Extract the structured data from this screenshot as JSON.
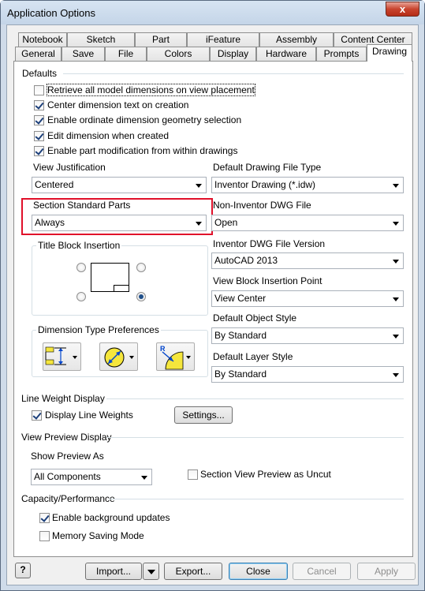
{
  "window": {
    "title": "Application Options",
    "close_glyph": "x"
  },
  "tabs": {
    "row1": [
      "Notebook",
      "Sketch",
      "Part",
      "iFeature",
      "Assembly",
      "Content Center"
    ],
    "row2": [
      "General",
      "Save",
      "File",
      "Colors",
      "Display",
      "Hardware",
      "Prompts",
      "Drawing"
    ],
    "active": "Drawing"
  },
  "defaults": {
    "label": "Defaults",
    "checkboxes": [
      {
        "label": "Retrieve all model dimensions on view placement",
        "checked": false
      },
      {
        "label": "Center dimension text on creation",
        "checked": true
      },
      {
        "label": "Enable ordinate dimension geometry selection",
        "checked": true
      },
      {
        "label": "Edit dimension when created",
        "checked": true
      },
      {
        "label": "Enable part modification from within drawings",
        "checked": true
      }
    ]
  },
  "view_justification": {
    "label": "View Justification",
    "value": "Centered"
  },
  "section_standard_parts": {
    "label": "Section Standard Parts",
    "value": "Always",
    "highlight_color": "#e0102a"
  },
  "title_block_insertion": {
    "label": "Title Block Insertion",
    "selected": "bottom-right"
  },
  "dimension_type_preferences": {
    "label": "Dimension Type Preferences",
    "icons": [
      "linear-dimension-icon",
      "diameter-dimension-icon",
      "radius-dimension-icon"
    ]
  },
  "right_column": {
    "default_drawing_file_type": {
      "label": "Default Drawing File Type",
      "value": "Inventor Drawing (*.idw)"
    },
    "non_inventor_dwg_file": {
      "label": "Non-Inventor DWG File",
      "value": "Open"
    },
    "inventor_dwg_file_version": {
      "label": "Inventor DWG File Version",
      "value": "AutoCAD 2013"
    },
    "view_block_insertion_point": {
      "label": "View Block Insertion Point",
      "value": "View Center"
    },
    "default_object_style": {
      "label": "Default Object Style",
      "value": "By Standard"
    },
    "default_layer_style": {
      "label": "Default Layer Style",
      "value": "By Standard"
    }
  },
  "line_weight_display": {
    "label": "Line Weight Display",
    "display_line_weights": {
      "label": "Display Line Weights",
      "checked": true
    },
    "settings_button": "Settings..."
  },
  "view_preview_display": {
    "label": "View Preview Display",
    "show_preview_as_label": "Show Preview As",
    "show_preview_as_value": "All Components",
    "section_view_uncut": {
      "label": "Section View Preview as Uncut",
      "checked": false
    }
  },
  "capacity_performance": {
    "label": "Capacity/Performance",
    "enable_background_updates": {
      "label": "Enable background updates",
      "checked": true
    },
    "memory_saving_mode": {
      "label": "Memory Saving Mode",
      "checked": false
    }
  },
  "footer": {
    "help_glyph": "?",
    "import": "Import...",
    "export": "Export...",
    "close": "Close",
    "cancel": "Cancel",
    "apply": "Apply"
  }
}
